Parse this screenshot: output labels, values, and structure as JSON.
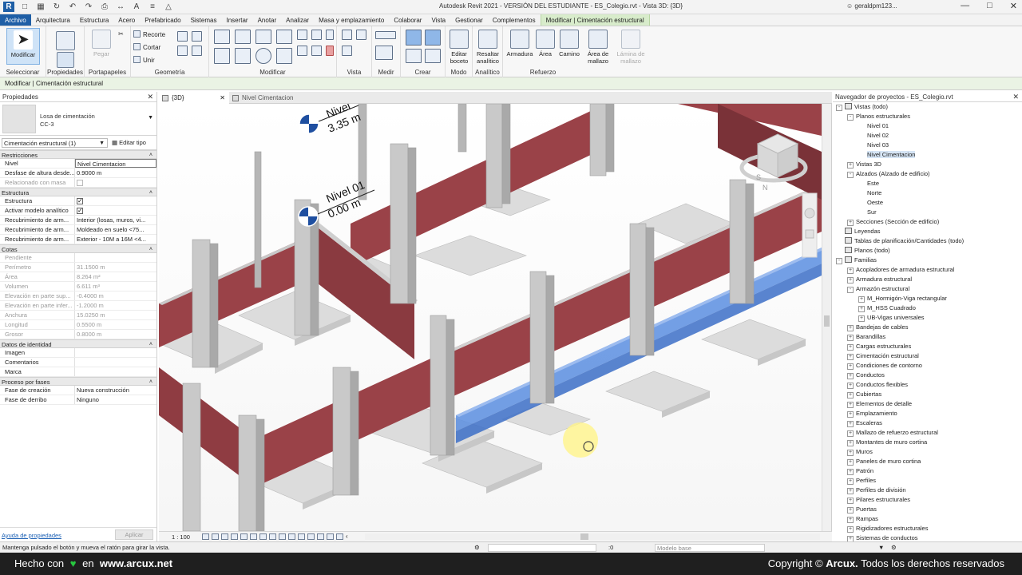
{
  "titlebar": {
    "title": "Autodesk Revit 2021 - VERSIÓN DEL ESTUDIANTE - ES_Colegio.rvt - Vista 3D: {3D}",
    "user": "geraldpm123..."
  },
  "tabs": [
    "Archivo",
    "Arquitectura",
    "Estructura",
    "Acero",
    "Prefabricado",
    "Sistemas",
    "Insertar",
    "Anotar",
    "Analizar",
    "Masa y emplazamiento",
    "Colaborar",
    "Vista",
    "Gestionar",
    "Complementos",
    "Modificar | Cimentación estructural"
  ],
  "ribbon": {
    "modify": "Modificar",
    "paste": "Pegar",
    "clipboard_items": [
      "Recorte",
      "Cortar",
      "Unir"
    ],
    "panels": [
      "Seleccionar",
      "Propiedades",
      "Portapapeles",
      "Geometría",
      "Modificar",
      "Vista",
      "Medir",
      "Crear",
      "Modo",
      "Analítico",
      "Refuerzo"
    ],
    "edit_sketch": "Editar boceto",
    "highlight_analytical": "Resaltar analítico",
    "rebar": [
      "Armadura",
      "Área",
      "Camino"
    ],
    "mesh_area": "Área de mallazo",
    "mesh_sheet": "Lámina de mallazo"
  },
  "context_bar": "Modificar | Cimentación estructural",
  "properties": {
    "title": "Propiedades",
    "type_name": "Losa de cimentación",
    "type_sub": "CC-3",
    "instance_filter": "Cimentación estructural (1)",
    "edit_type": "Editar tipo",
    "sections": [
      {
        "name": "Restricciones",
        "rows": [
          {
            "k": "Nivel",
            "v": "Nivel Cimentacion",
            "boxed": true
          },
          {
            "k": "Desfase de altura desde...",
            "v": "0.9000 m"
          },
          {
            "k": "Relacionado con masa",
            "v": "",
            "check": "off",
            "dim": true
          }
        ]
      },
      {
        "name": "Estructura",
        "rows": [
          {
            "k": "Estructura",
            "v": "",
            "check": "on"
          },
          {
            "k": "Activar modelo analítico",
            "v": "",
            "check": "on"
          },
          {
            "k": "Recubrimiento de arm...",
            "v": "Interior (losas, muros, vi..."
          },
          {
            "k": "Recubrimiento de arm...",
            "v": "Moldeado en suelo <75..."
          },
          {
            "k": "Recubrimiento de arm...",
            "v": "Exterior - 10M a 16M <4..."
          }
        ]
      },
      {
        "name": "Cotas",
        "rows": [
          {
            "k": "Pendiente",
            "v": "",
            "dim": true
          },
          {
            "k": "Perímetro",
            "v": "31.1500 m",
            "dim": true
          },
          {
            "k": "Área",
            "v": "8.264 m²",
            "dim": true
          },
          {
            "k": "Volumen",
            "v": "6.611 m³",
            "dim": true
          },
          {
            "k": "Elevación en parte sup...",
            "v": "-0.4000 m",
            "dim": true
          },
          {
            "k": "Elevación en parte infer...",
            "v": "-1.2000 m",
            "dim": true
          },
          {
            "k": "Anchura",
            "v": "15.0250 m",
            "dim": true
          },
          {
            "k": "Longitud",
            "v": "0.5500 m",
            "dim": true
          },
          {
            "k": "Grosor",
            "v": "0.8000 m",
            "dim": true
          }
        ]
      },
      {
        "name": "Datos de identidad",
        "rows": [
          {
            "k": "Imagen",
            "v": ""
          },
          {
            "k": "Comentarios",
            "v": ""
          },
          {
            "k": "Marca",
            "v": ""
          }
        ]
      },
      {
        "name": "Proceso por fases",
        "rows": [
          {
            "k": "Fase de creación",
            "v": "Nueva construcción"
          },
          {
            "k": "Fase de derribo",
            "v": "Ninguno"
          }
        ]
      }
    ],
    "help_link": "Ayuda de propiedades",
    "apply": "Aplicar"
  },
  "view": {
    "tabs": [
      "{3D}",
      "Nivel Cimentacion"
    ],
    "level_tags": [
      {
        "name": "Nivel",
        "elev": "3.35 m"
      },
      {
        "name": "Nivel 01",
        "elev": "0.00 m"
      }
    ],
    "scale": "1 : 100",
    "viewcube_faces": [
      "S",
      "N"
    ]
  },
  "browser": {
    "title": "Navegador de proyectos - ES_Colegio.rvt",
    "tree": [
      {
        "t": "Vistas (todo)",
        "d": 0,
        "pm": "-",
        "ic": true
      },
      {
        "t": "Planos estructurales",
        "d": 1,
        "pm": "-"
      },
      {
        "t": "Nivel 01",
        "d": 2
      },
      {
        "t": "Nivel 02",
        "d": 2
      },
      {
        "t": "Nivel 03",
        "d": 2
      },
      {
        "t": "Nivel Cimentacion",
        "d": 2,
        "sel": true
      },
      {
        "t": "Vistas 3D",
        "d": 1,
        "pm": "+"
      },
      {
        "t": "Alzados (Alzado de edificio)",
        "d": 1,
        "pm": "-"
      },
      {
        "t": "Este",
        "d": 2
      },
      {
        "t": "Norte",
        "d": 2
      },
      {
        "t": "Oeste",
        "d": 2
      },
      {
        "t": "Sur",
        "d": 2
      },
      {
        "t": "Secciones (Sección de edificio)",
        "d": 1,
        "pm": "+"
      },
      {
        "t": "Leyendas",
        "d": 0,
        "ic": true
      },
      {
        "t": "Tablas de planificación/Cantidades (todo)",
        "d": 0,
        "ic": true
      },
      {
        "t": "Planos (todo)",
        "d": 0,
        "ic": true
      },
      {
        "t": "Familias",
        "d": 0,
        "pm": "-",
        "ic": true
      },
      {
        "t": "Acopladores de armadura estructural",
        "d": 1,
        "pm": "+"
      },
      {
        "t": "Armadura estructural",
        "d": 1,
        "pm": "+"
      },
      {
        "t": "Armazón estructural",
        "d": 1,
        "pm": "-"
      },
      {
        "t": "M_Hormigón-Viga rectangular",
        "d": 2,
        "pm": "+"
      },
      {
        "t": "M_HSS Cuadrado",
        "d": 2,
        "pm": "+"
      },
      {
        "t": "UB-Vigas universales",
        "d": 2,
        "pm": "+"
      },
      {
        "t": "Bandejas de cables",
        "d": 1,
        "pm": "+"
      },
      {
        "t": "Barandillas",
        "d": 1,
        "pm": "+"
      },
      {
        "t": "Cargas estructurales",
        "d": 1,
        "pm": "+"
      },
      {
        "t": "Cimentación estructural",
        "d": 1,
        "pm": "+"
      },
      {
        "t": "Condiciones de contorno",
        "d": 1,
        "pm": "+"
      },
      {
        "t": "Conductos",
        "d": 1,
        "pm": "+"
      },
      {
        "t": "Conductos flexibles",
        "d": 1,
        "pm": "+"
      },
      {
        "t": "Cubiertas",
        "d": 1,
        "pm": "+"
      },
      {
        "t": "Elementos de detalle",
        "d": 1,
        "pm": "+"
      },
      {
        "t": "Emplazamiento",
        "d": 1,
        "pm": "+"
      },
      {
        "t": "Escaleras",
        "d": 1,
        "pm": "+"
      },
      {
        "t": "Mallazo de refuerzo estructural",
        "d": 1,
        "pm": "+"
      },
      {
        "t": "Montantes de muro cortina",
        "d": 1,
        "pm": "+"
      },
      {
        "t": "Muros",
        "d": 1,
        "pm": "+"
      },
      {
        "t": "Paneles de muro cortina",
        "d": 1,
        "pm": "+"
      },
      {
        "t": "Patrón",
        "d": 1,
        "pm": "+"
      },
      {
        "t": "Perfiles",
        "d": 1,
        "pm": "+"
      },
      {
        "t": "Perfiles de división",
        "d": 1,
        "pm": "+"
      },
      {
        "t": "Pilares estructurales",
        "d": 1,
        "pm": "+"
      },
      {
        "t": "Puertas",
        "d": 1,
        "pm": "+"
      },
      {
        "t": "Rampas",
        "d": 1,
        "pm": "+"
      },
      {
        "t": "Rigidizadores estructurales",
        "d": 1,
        "pm": "+"
      },
      {
        "t": "Sistemas de conductos",
        "d": 1,
        "pm": "+"
      }
    ]
  },
  "status": {
    "message": "Mantenga pulsado el botón y mueva el ratón para girar la vista.",
    "zero": ":0",
    "model": "Modelo base"
  },
  "footer": {
    "left_a": "Hecho con",
    "left_b": "en",
    "site": "www.arcux.net",
    "copy": "Copyright ©",
    "brand": "Arcux.",
    "rights": "Todos los derechos reservados"
  },
  "colors": {
    "file_tab": "#1f5fa6",
    "context_tab": "#d8eccb",
    "beam_red": "#9a4248",
    "selected_blue": "#5a8ee0",
    "concrete": "#c9c9c9"
  }
}
